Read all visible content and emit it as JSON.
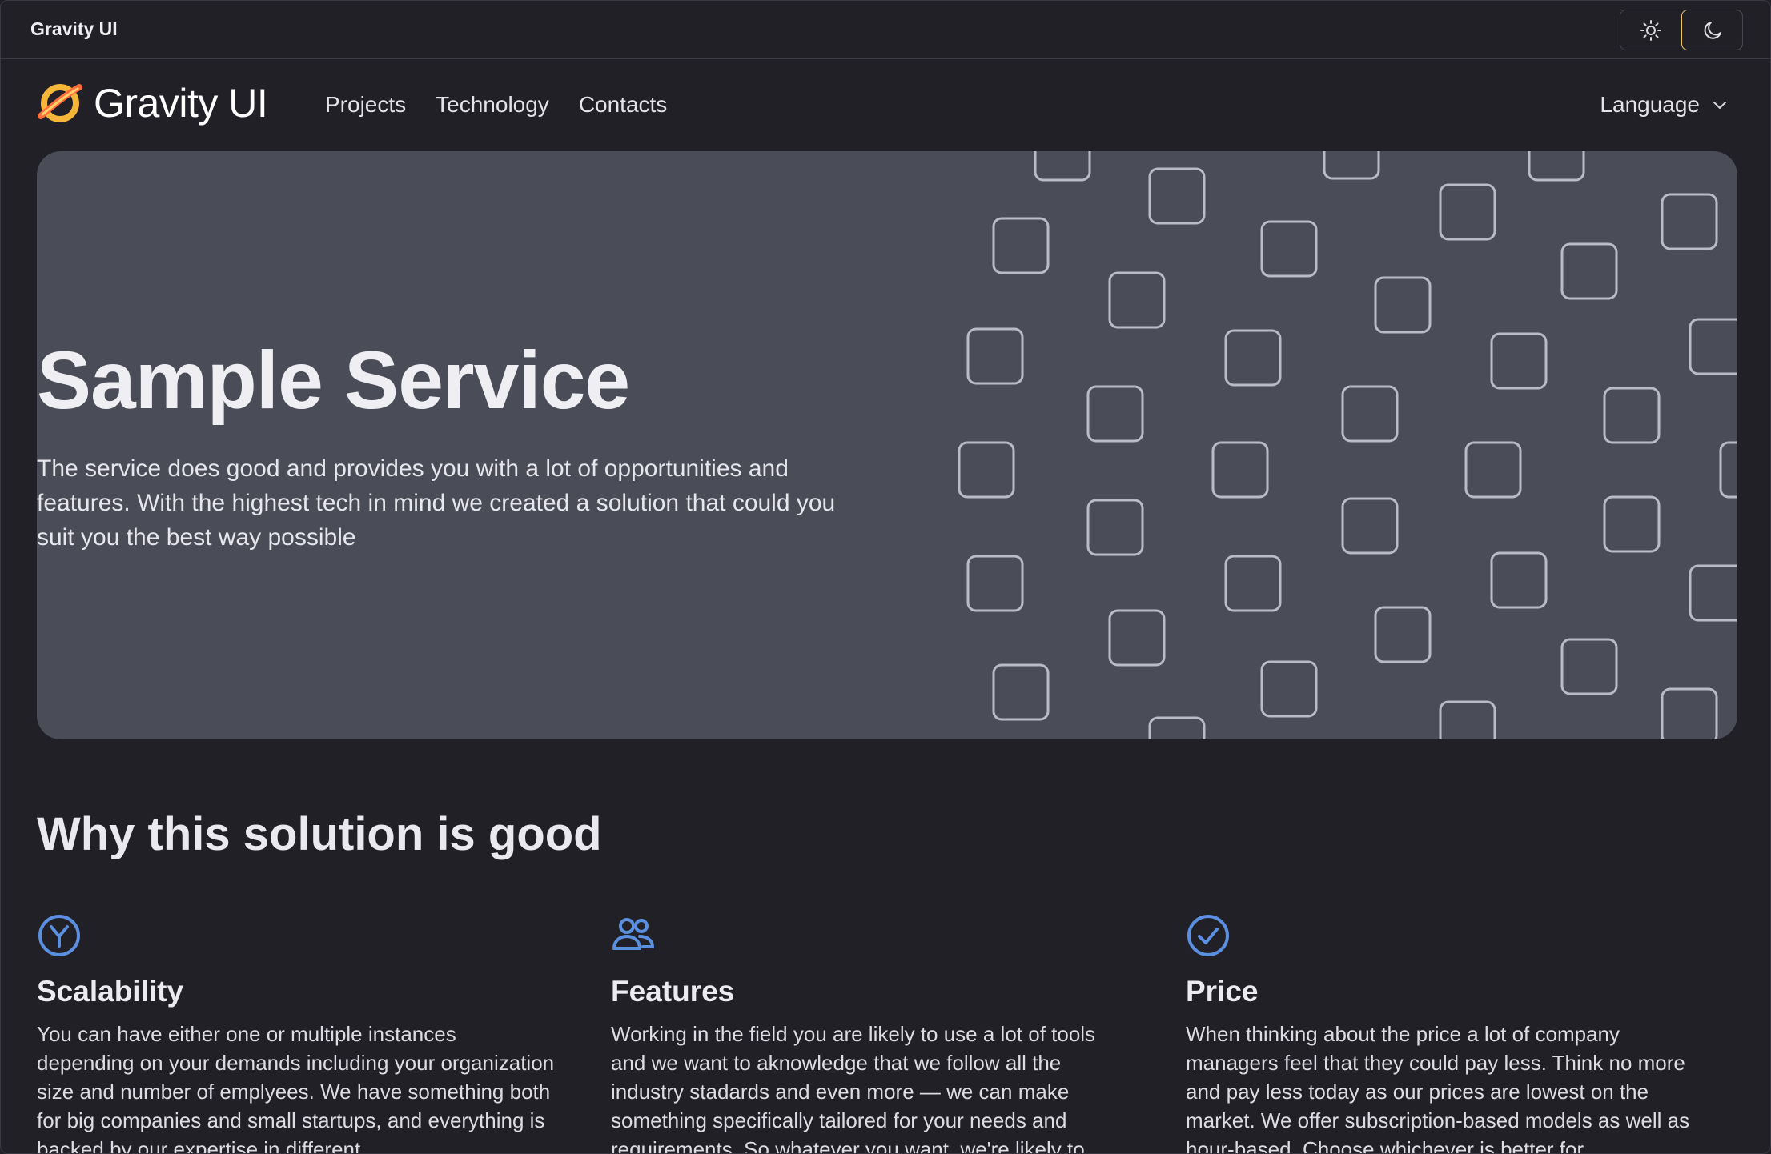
{
  "topbar": {
    "title": "Gravity UI"
  },
  "theme_switch": {
    "options": [
      "light-theme",
      "dark-theme"
    ],
    "selected": "dark-theme",
    "accent": "#f2c265"
  },
  "nav": {
    "logo_text": "Gravity UI",
    "links": [
      "Projects",
      "Technology",
      "Contacts"
    ],
    "language_label": "Language"
  },
  "hero": {
    "title": "Sample Service",
    "text": "The service does good and provides you with a lot of opportunities and features. With the highest tech in mind we created a solution that could you suit you the best way possible",
    "background": "#4a4c58"
  },
  "section": {
    "title": "Why this solution is good",
    "features": [
      {
        "icon": "scalability-icon",
        "title": "Scalability",
        "text": "You can have either one or multiple instances depending on your demands including your organization size and number of emplyees. We have something both for big companies and small startups, and everything is backed by our expertise in different"
      },
      {
        "icon": "persons-icon",
        "title": "Features",
        "text": "Working in the field you are likely to use a lot of tools and we want to aknowledge that we follow all the industry stadards and even more — we can make something specifically tailored for your needs and requirements. So whatever you want, we're likely to"
      },
      {
        "icon": "circle-check-icon",
        "title": "Price",
        "text": "When thinking about the price a lot of company managers feel that they could pay less. Think no more and pay less today as our prices are lowest on the market. We offer subscription-based models as well as hour-based. Choose whichever is better for"
      }
    ],
    "icon_color": "#5b8fe0"
  }
}
